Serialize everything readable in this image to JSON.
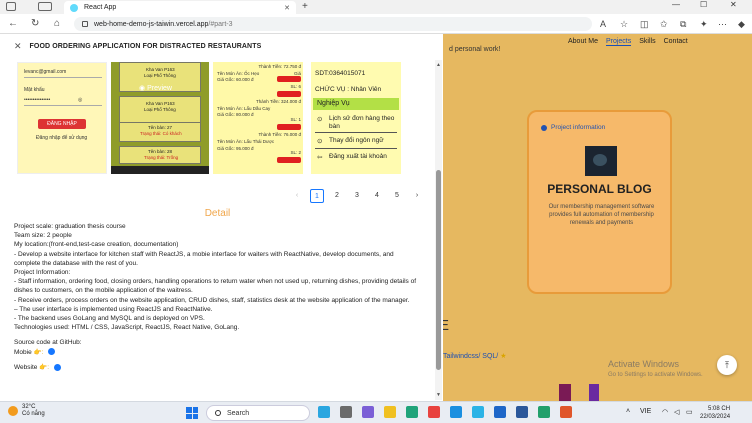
{
  "browser": {
    "tab_title": "React App",
    "url_host": "web-home-demo-js-taiwin.vercel.app",
    "url_path": "/#part-3"
  },
  "page": {
    "tagline": "d personal work!",
    "nav": [
      "About Me",
      "Projects",
      "Skills",
      "Contact"
    ],
    "active_nav": "Projects",
    "card": {
      "badge": "Project information",
      "title": "PERSONAL BLOG",
      "description": "Our membership management software provides full automation of membership renewals and payments"
    },
    "section_letter": "E",
    "tech_line": "Tailwindcss/ SQL/",
    "watermark_title": "Activate Windows",
    "watermark_sub": "Go to Settings to activate Windows."
  },
  "modal": {
    "title": "FOOD ORDERING APPLICATION FOR DISTRACTED RESTAURANTS",
    "screens": {
      "login": {
        "email": "levanc@gmail.com",
        "password_label": "Mật khẩu",
        "password_value": "•••••••••••••••",
        "button": "ĐĂNG NHẬP",
        "register": "Đăng nhập để sử dụng"
      },
      "preview_label": "Preview",
      "menu_cards": [
        {
          "name": "Kha Van P163",
          "type": "Loại Phổ Thông"
        },
        {
          "name": "Kha Van P163",
          "type": "Loại Phổ Thông"
        },
        {
          "name": "Tên bàn: 27",
          "type": "Trạng thái: Có khách"
        },
        {
          "name": "Tên bàn: 28",
          "type": "Trạng thái: Trống"
        }
      ],
      "orders": [
        {
          "line1": "Thành Tiền: 72.750 đ",
          "line2": "Giá"
        },
        {
          "line1": "Tên Món Ăn: Ốc Hẹo",
          "line2": "Giá Gốc: 60.000 đ"
        },
        {
          "line1": "SL: 6",
          "line2": "Thành Tiền: 324.000 đ"
        },
        {
          "line1": "Tên Món Ăn: Lẩu Dầu Cay",
          "line2": "Giá Gốc: 80.000 đ"
        },
        {
          "line1": "SL: 1",
          "line2": "Thành Tiền: 76.000 đ"
        },
        {
          "line1": "Tên Món Ăn: Lẩu Thái Dược",
          "line2": "Giá Gốc: 95.000 đ"
        },
        {
          "line1": "SL: 2",
          "line2": ""
        }
      ],
      "profile": {
        "phone": "SDT:0364015071",
        "role": "CHỨC VỤ : Nhân Viên",
        "section": "Nghiệp Vụ",
        "items": [
          "Lịch sử đơn hàng theo bàn",
          "Thay đổi ngôn ngữ",
          "Đăng xuất tài khoản"
        ]
      }
    },
    "pagination": {
      "prev": "‹",
      "pages": [
        "1",
        "2",
        "3",
        "4",
        "5"
      ],
      "active": "1",
      "next": "›"
    },
    "detail_heading": "Detail",
    "detail_lines": [
      "Project scale: graduation thesis course",
      "Team size: 2 people",
      "My location:(front-end,test-case creation, documentation)",
      "- Develop a website interface for kitchen staff with ReactJS, a mobie interface for waiters with ReactNative, develop documents, and complete the database with the rest of you.",
      "Project Information:",
      "- Staff information, ordering food, closing orders, handling operations to return water when not used up, returning dishes, providing details of dishes to customers, on the mobile application of the waitress.",
      "- Receive orders, process orders on the website application, CRUD dishes, staff, statistics desk at the website application of the manager.",
      "– The user interface is implemented using ReactJS and ReactNative.",
      "- The backend uses GoLang and MySQL and is deployed on VPS.",
      "Technologies used: HTML / CSS, JavaScript, ReactJS, React Native, GoLang."
    ],
    "source_heading": "Source code at GitHub:",
    "mobile_label": "Mobie",
    "website_label": "Website"
  },
  "taskbar": {
    "temperature": "32°C",
    "weather": "Có nắng",
    "search": "Search",
    "lang": "VIE",
    "time": "5:08 CH",
    "date": "22/03/2024"
  },
  "colors": {
    "accent": "#1677ff",
    "detail": "#f0a64a",
    "page_bg": "#e6b860"
  }
}
